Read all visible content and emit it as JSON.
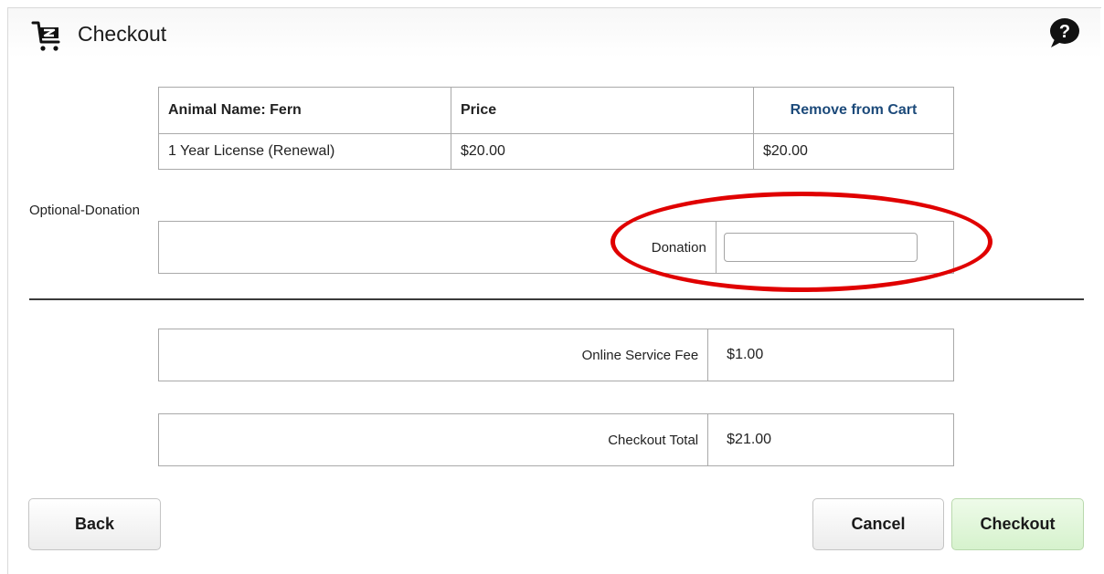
{
  "header": {
    "title": "Checkout",
    "cart_icon": "cart-icon",
    "help_icon": "help-icon"
  },
  "cart": {
    "headers": [
      "Animal Name: Fern",
      "Price",
      "Remove from Cart"
    ],
    "rows": [
      [
        "1 Year License (Renewal)",
        "$20.00",
        "$20.00"
      ]
    ]
  },
  "donation": {
    "section_label": "Optional-Donation",
    "field_label": "Donation",
    "value": "",
    "highlight_color": "#e00000"
  },
  "fee": {
    "label": "Online Service Fee",
    "value": "$1.00"
  },
  "total": {
    "label": "Checkout Total",
    "value": "$21.00"
  },
  "buttons": {
    "back": "Back",
    "cancel": "Cancel",
    "checkout": "Checkout"
  },
  "colors": {
    "link": "#1c4a7a",
    "checkout_button": "#d6f2cd",
    "annotation": "#e00000"
  }
}
